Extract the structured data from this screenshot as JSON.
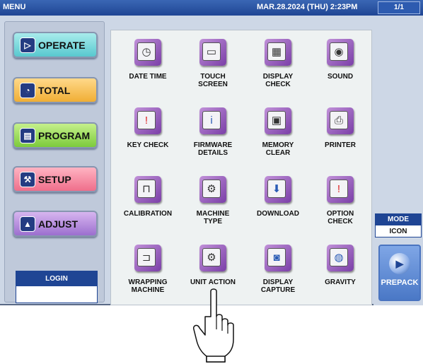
{
  "titlebar": {
    "menu": "MENU",
    "datetime": "MAR.28.2024 (THU)  2:23PM",
    "page": "1/1"
  },
  "nav": {
    "operate": "OPERATE",
    "total": "TOTAL",
    "program": "PROGRAM",
    "setup": "SETUP",
    "adjust": "ADJUST"
  },
  "login": {
    "label": "LOGIN",
    "value": ""
  },
  "tiles": [
    {
      "label": "DATE TIME",
      "icon": "calendar-clock-icon"
    },
    {
      "label": "TOUCH\nSCREEN",
      "icon": "touch-screen-icon"
    },
    {
      "label": "DISPLAY\nCHECK",
      "icon": "display-check-icon"
    },
    {
      "label": "SOUND",
      "icon": "speaker-icon"
    },
    {
      "label": "KEY CHECK",
      "icon": "key-check-icon"
    },
    {
      "label": "FIRMWARE\nDETAILS",
      "icon": "info-icon"
    },
    {
      "label": "MEMORY\nCLEAR",
      "icon": "memory-clear-icon"
    },
    {
      "label": "PRINTER",
      "icon": "printer-icon"
    },
    {
      "label": "CALIBRATION",
      "icon": "calibration-icon"
    },
    {
      "label": "MACHINE\nTYPE",
      "icon": "gears-icon"
    },
    {
      "label": "DOWNLOAD",
      "icon": "download-icon"
    },
    {
      "label": "OPTION\nCHECK",
      "icon": "option-check-icon"
    },
    {
      "label": "WRAPPING\nMACHINE",
      "icon": "wrapping-machine-icon"
    },
    {
      "label": "UNIT ACTION",
      "icon": "gears-icon"
    },
    {
      "label": "DISPLAY\nCAPTURE",
      "icon": "camera-icon"
    },
    {
      "label": "GRAVITY",
      "icon": "gravity-icon"
    }
  ],
  "mode": {
    "label": "MODE",
    "value": "ICON"
  },
  "prepack": {
    "label": "PREPACK",
    "icon": "play-icon"
  },
  "pointer": {
    "icon": "pointing-hand-icon"
  },
  "colors": {
    "titlebar": "#1f4594",
    "tile_icon": "#7b3fa8",
    "background": "#cdd7e6"
  }
}
